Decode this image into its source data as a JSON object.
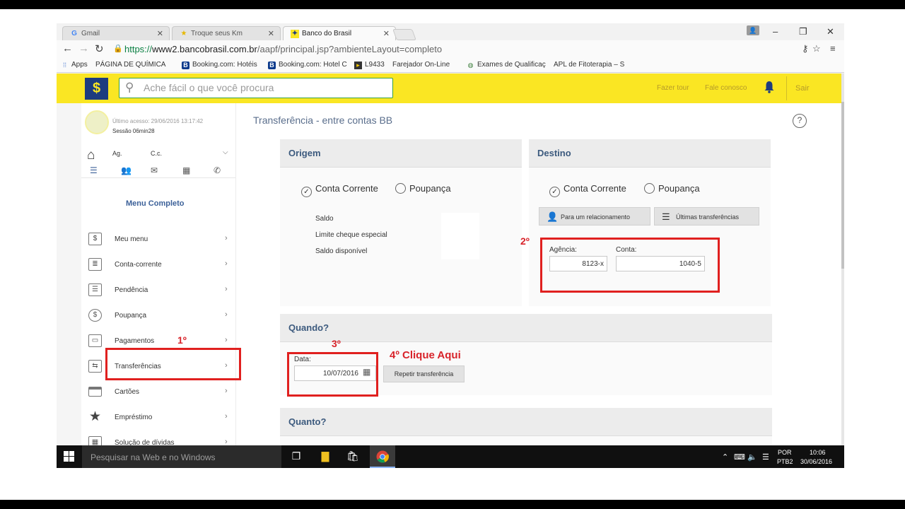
{
  "tabs": [
    {
      "label": "Gmail",
      "favicon": "G"
    },
    {
      "label": "Troque seus Km",
      "favicon": "★"
    },
    {
      "label": "Banco do Brasil",
      "favicon": "✦"
    }
  ],
  "address": {
    "scheme": "https://",
    "host": "www2.bancobrasil.com.br",
    "path": "/aapf/principal.jsp?ambienteLayout=completo"
  },
  "bookmarks": [
    {
      "label": "Apps",
      "icon": "apps-grid-icon"
    },
    {
      "label": "PÁGINA DE QUÍMICA",
      "icon": "page-icon"
    },
    {
      "label": "Booking.com: Hotéis",
      "icon": "booking-icon"
    },
    {
      "label": "Booking.com: Hotel C",
      "icon": "booking-icon"
    },
    {
      "label": "L9433",
      "icon": "flag-icon"
    },
    {
      "label": "Farejador On-Line",
      "icon": "page-icon"
    },
    {
      "label": "Exames de Qualificaç",
      "icon": "globe-icon"
    },
    {
      "label": "APL de Fitoterapia – S",
      "icon": "page-icon"
    }
  ],
  "header": {
    "search_placeholder": "Ache fácil o que você procura",
    "tour": "Fazer tour",
    "contact": "Fale conosco",
    "logout": "Sair",
    "brand_color": "#fae623",
    "logo_color": "#1d3c7f"
  },
  "sidebar": {
    "last_access": "Último acesso: 29/06/2016 13:17:42",
    "session": "Sessão 06min28",
    "agency_label": "Ag.",
    "account_label": "C.c.",
    "menu_title": "Menu Completo",
    "items": [
      {
        "label": "Meu menu",
        "icon": "bb-logo-icon"
      },
      {
        "label": "Conta-corrente",
        "icon": "document-icon"
      },
      {
        "label": "Pendência",
        "icon": "checklist-icon"
      },
      {
        "label": "Poupança",
        "icon": "piggy-bank-icon"
      },
      {
        "label": "Pagamentos",
        "icon": "barcode-icon"
      },
      {
        "label": "Transferências",
        "icon": "transfer-icon"
      },
      {
        "label": "Cartões",
        "icon": "card-icon"
      },
      {
        "label": "Empréstimo",
        "icon": "star-icon"
      },
      {
        "label": "Solução de dívidas",
        "icon": "calculator-icon"
      }
    ]
  },
  "main": {
    "title": "Transferência - entre contas BB",
    "origem": {
      "title": "Origem",
      "radio_checking": "Conta Corrente",
      "radio_savings": "Poupança",
      "saldo": "Saldo",
      "limite": "Limite cheque especial",
      "disponivel": "Saldo disponível"
    },
    "destino": {
      "title": "Destino",
      "radio_checking": "Conta Corrente",
      "radio_savings": "Poupança",
      "btn_relationship": "Para um relacionamento",
      "btn_last": "Últimas transferências",
      "agencia_label": "Agência:",
      "agencia_value": "8123-x",
      "conta_label": "Conta:",
      "conta_value": "1040-5"
    },
    "quando": {
      "title": "Quando?",
      "data_label": "Data:",
      "data_value": "10/07/2016",
      "repeat_btn": "Repetir transferência"
    },
    "quanto": {
      "title": "Quanto?"
    }
  },
  "annotations": {
    "step1": "1º",
    "step2": "2º",
    "step3": "3º",
    "step4": "4º Clique Aqui",
    "color": "#e0201f"
  },
  "taskbar": {
    "search_placeholder": "Pesquisar na Web e no Windows",
    "lang_top": "POR",
    "lang_bottom": "PTB2",
    "time": "10:06",
    "date": "30/06/2016"
  }
}
